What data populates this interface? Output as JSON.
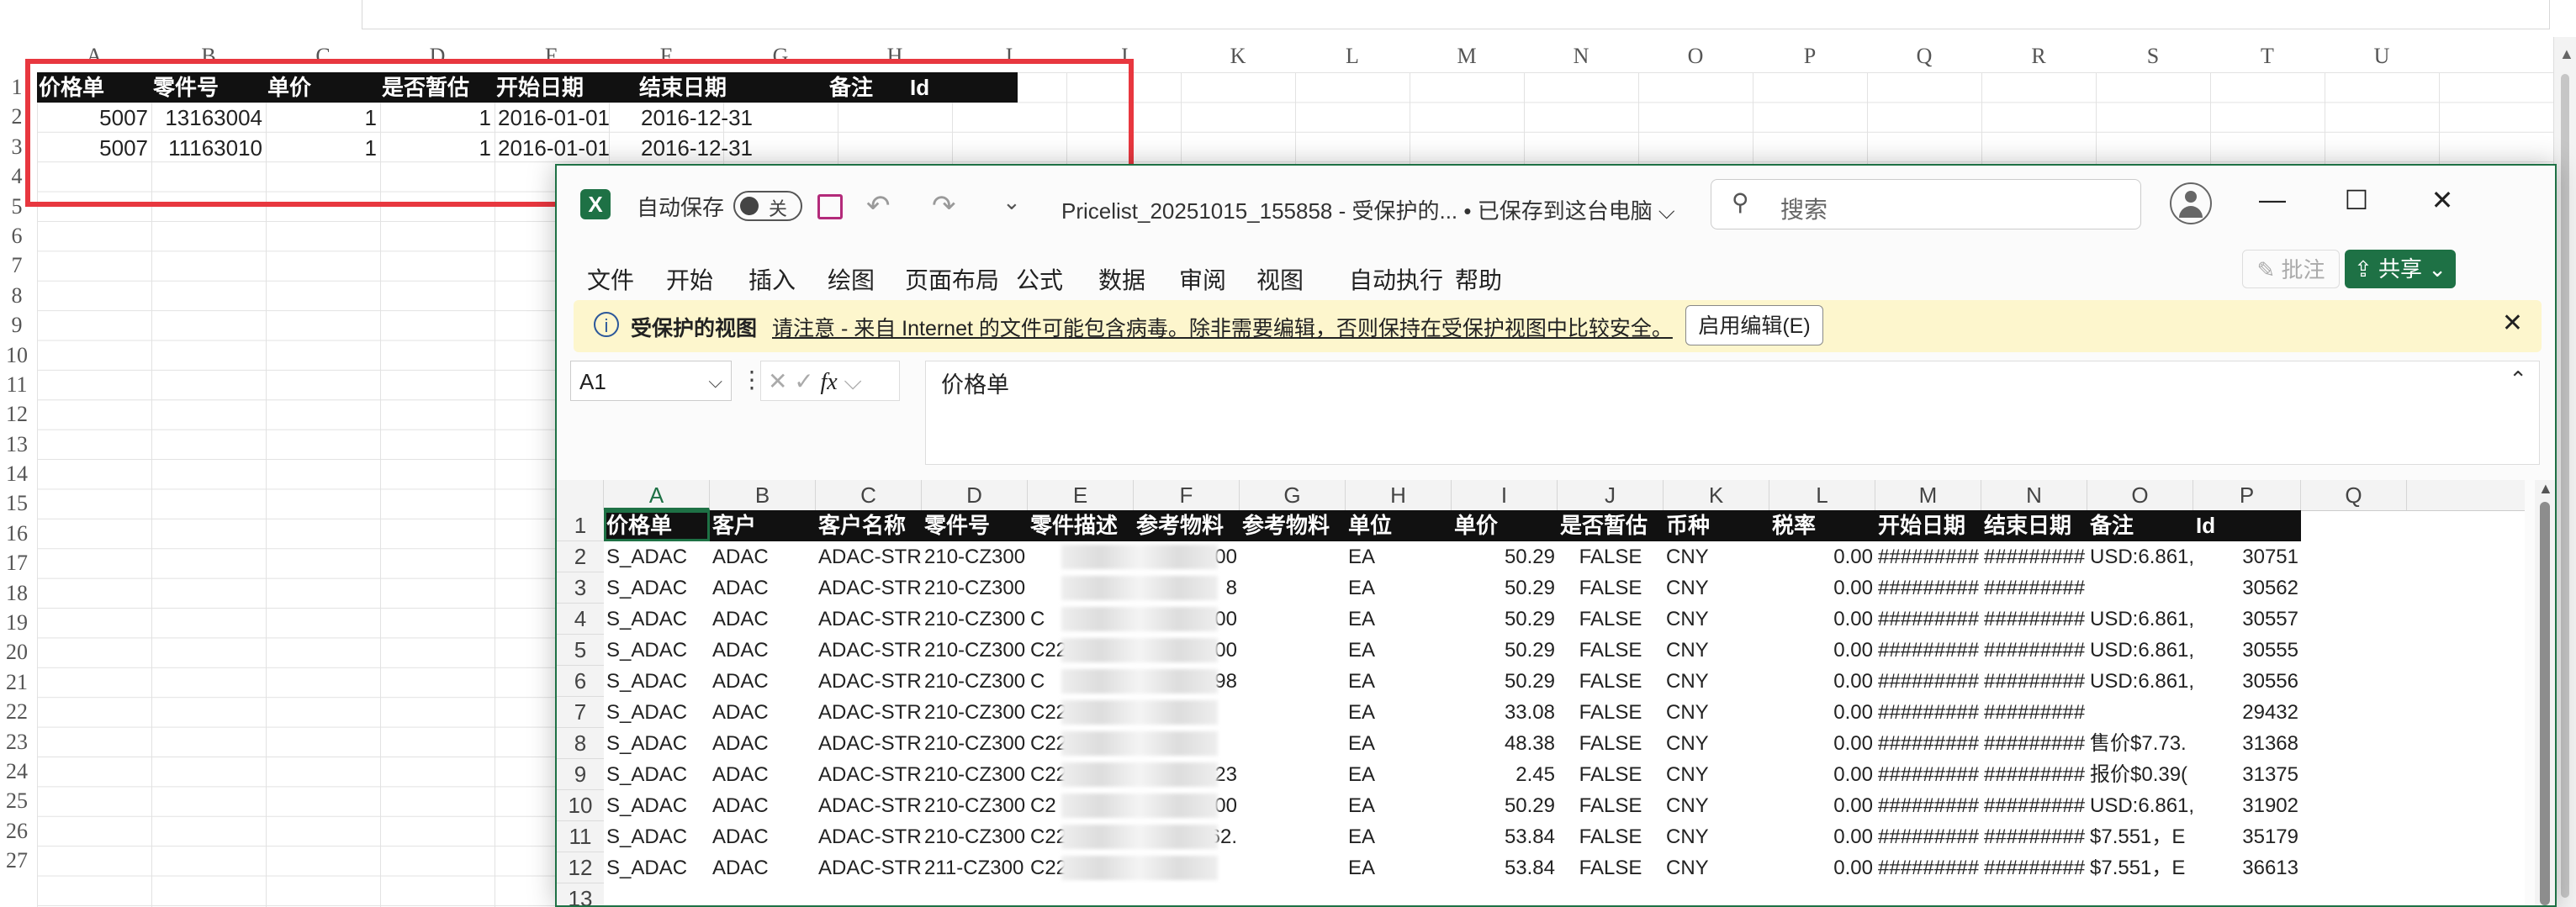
{
  "background_sheet": {
    "col_letters": [
      "A",
      "B",
      "C",
      "D",
      "E",
      "F",
      "G",
      "H",
      "I",
      "J",
      "K",
      "L",
      "M",
      "N",
      "O",
      "P",
      "Q",
      "R",
      "S",
      "T",
      "U"
    ],
    "row_numbers": [
      "1",
      "2",
      "3",
      "4",
      "5",
      "6",
      "7",
      "8",
      "9",
      "10",
      "11",
      "12",
      "13",
      "14",
      "15",
      "16",
      "17",
      "18",
      "19",
      "20",
      "21",
      "22",
      "23",
      "24",
      "25",
      "26",
      "27"
    ],
    "headers": [
      "价格单",
      "零件号",
      "单价",
      "是否暂估",
      "开始日期",
      "结束日期",
      "备注",
      "Id"
    ],
    "rows": [
      [
        "5007",
        "13163004",
        "1",
        "1",
        "2016-01-01",
        "2016-12-31"
      ],
      [
        "5007",
        "11163010",
        "1",
        "1",
        "2016-01-01",
        "2016-12-31"
      ]
    ],
    "highlight_color": "#e8373f"
  },
  "excel_window": {
    "autosave_label": "自动保存",
    "autosave_toggle": "关",
    "doc_title": "Pricelist_20251015_155858  -  受保护的...  •  已保存到这台电脑 ⌵",
    "search_placeholder": "搜索",
    "window_buttons": {
      "minimize": "—",
      "maximize": "☐",
      "close": "✕"
    },
    "menu": [
      "文件",
      "开始",
      "插入",
      "绘图",
      "页面布局",
      "公式",
      "数据",
      "审阅",
      "视图",
      "自动执行",
      "帮助"
    ],
    "annotate_label": "批注",
    "share_label": "共享",
    "protected_view": {
      "title": "受保护的视图",
      "message": "请注意 - 来自 Internet 的文件可能包含病毒。除非需要编辑，否则保持在受保护视图中比较安全。",
      "enable_button": "启用编辑(E)"
    },
    "name_box": "A1",
    "formula_value": "价格单",
    "col_letters": [
      "A",
      "B",
      "C",
      "D",
      "E",
      "F",
      "G",
      "H",
      "I",
      "J",
      "K",
      "L",
      "M",
      "N",
      "O",
      "P",
      "Q"
    ],
    "row_numbers": [
      "1",
      "2",
      "3",
      "4",
      "5",
      "6",
      "7",
      "8",
      "9",
      "10",
      "11",
      "12",
      "13"
    ],
    "table_headers": [
      "价格单",
      "客户",
      "客户名称",
      "零件号",
      "零件描述",
      "参考物料",
      "参考物料",
      "单位",
      "单价",
      "是否暂估",
      "币种",
      "税率",
      "开始日期",
      "结束日期",
      "备注",
      "Id"
    ],
    "table_rows": [
      {
        "price_list": "S_ADAC",
        "customer": "ADAC",
        "customer_name": "ADAC-STRA",
        "part_no": "210-CZ300",
        "desc": "",
        "ref1": "000",
        "ref2": "",
        "unit": "EA",
        "price": "50.29",
        "provisional": "FALSE",
        "currency": "CNY",
        "tax": "0.00",
        "start": "#########",
        "end": "#########",
        "note": "USD:6.861,",
        "id": "30751"
      },
      {
        "price_list": "S_ADAC",
        "customer": "ADAC",
        "customer_name": "ADAC-STRA",
        "part_no": "210-CZ300",
        "desc": "",
        "ref1": "8",
        "ref2": "",
        "unit": "EA",
        "price": "50.29",
        "provisional": "FALSE",
        "currency": "CNY",
        "tax": "0.00",
        "start": "#########",
        "end": "#########",
        "note": "",
        "id": "30562"
      },
      {
        "price_list": "S_ADAC",
        "customer": "ADAC",
        "customer_name": "ADAC-STRA",
        "part_no": "210-CZ300",
        "desc": "C",
        "ref1": "000",
        "ref2": "",
        "unit": "EA",
        "price": "50.29",
        "provisional": "FALSE",
        "currency": "CNY",
        "tax": "0.00",
        "start": "#########",
        "end": "#########",
        "note": "USD:6.861,",
        "id": "30557"
      },
      {
        "price_list": "S_ADAC",
        "customer": "ADAC",
        "customer_name": "ADAC-STRA",
        "part_no": "210-CZ300",
        "desc": "C22",
        "ref1": "6000",
        "ref2": "",
        "unit": "EA",
        "price": "50.29",
        "provisional": "FALSE",
        "currency": "CNY",
        "tax": "0.00",
        "start": "#########",
        "end": "#########",
        "note": "USD:6.861,",
        "id": "30555"
      },
      {
        "price_list": "S_ADAC",
        "customer": "ADAC",
        "customer_name": "ADAC-STRA",
        "part_no": "210-CZ300",
        "desc": "C",
        "ref1": "498",
        "ref2": "",
        "unit": "EA",
        "price": "50.29",
        "provisional": "FALSE",
        "currency": "CNY",
        "tax": "0.00",
        "start": "#########",
        "end": "#########",
        "note": "USD:6.861,",
        "id": "30556"
      },
      {
        "price_list": "S_ADAC",
        "customer": "ADAC",
        "customer_name": "ADAC-STRA",
        "part_no": "210-CZ300",
        "desc": "C223",
        "ref1": "",
        "ref2": "",
        "unit": "EA",
        "price": "33.08",
        "provisional": "FALSE",
        "currency": "CNY",
        "tax": "0.00",
        "start": "#########",
        "end": "#########",
        "note": "",
        "id": "29432"
      },
      {
        "price_list": "S_ADAC",
        "customer": "ADAC",
        "customer_name": "ADAC-STRA",
        "part_no": "210-CZ300",
        "desc": "C223",
        "ref1": "",
        "ref2": "",
        "unit": "EA",
        "price": "48.38",
        "provisional": "FALSE",
        "currency": "CNY",
        "tax": "0.00",
        "start": "#########",
        "end": "#########",
        "note": "售价$7.73.",
        "id": "31368"
      },
      {
        "price_list": "S_ADAC",
        "customer": "ADAC",
        "customer_name": "ADAC-STRA",
        "part_no": "210-CZ300",
        "desc": "C223",
        "ref1": "C223",
        "ref2": "",
        "unit": "EA",
        "price": "2.45",
        "provisional": "FALSE",
        "currency": "CNY",
        "tax": "0.00",
        "start": "#########",
        "end": "#########",
        "note": "报价$0.39(",
        "id": "31375"
      },
      {
        "price_list": "S_ADAC",
        "customer": "ADAC",
        "customer_name": "ADAC-STRA",
        "part_no": "210-CZ300",
        "desc": "C2",
        "ref1": "00",
        "ref2": "",
        "unit": "EA",
        "price": "50.29",
        "provisional": "FALSE",
        "currency": "CNY",
        "tax": "0.00",
        "start": "#########",
        "end": "#########",
        "note": "USD:6.861,",
        "id": "31902"
      },
      {
        "price_list": "S_ADAC",
        "customer": "ADAC",
        "customer_name": "ADAC-STRA",
        "part_no": "210-CZ300",
        "desc": "C223/8062",
        "ref1": "8062.",
        "ref2": "",
        "unit": "EA",
        "price": "53.84",
        "provisional": "FALSE",
        "currency": "CNY",
        "tax": "0.00",
        "start": "#########",
        "end": "#########",
        "note": "$7.551，E",
        "id": "35179"
      },
      {
        "price_list": "S_ADAC",
        "customer": "ADAC",
        "customer_name": "ADAC-STRA",
        "part_no": "211-CZ300",
        "desc": "C22",
        "ref1": "",
        "ref2": "",
        "unit": "EA",
        "price": "53.84",
        "provisional": "FALSE",
        "currency": "CNY",
        "tax": "0.00",
        "start": "#########",
        "end": "#########",
        "note": "$7.551，E",
        "id": "36613"
      }
    ],
    "accent_color": "#1e7145",
    "msgbar_color": "#fdf6cd"
  }
}
